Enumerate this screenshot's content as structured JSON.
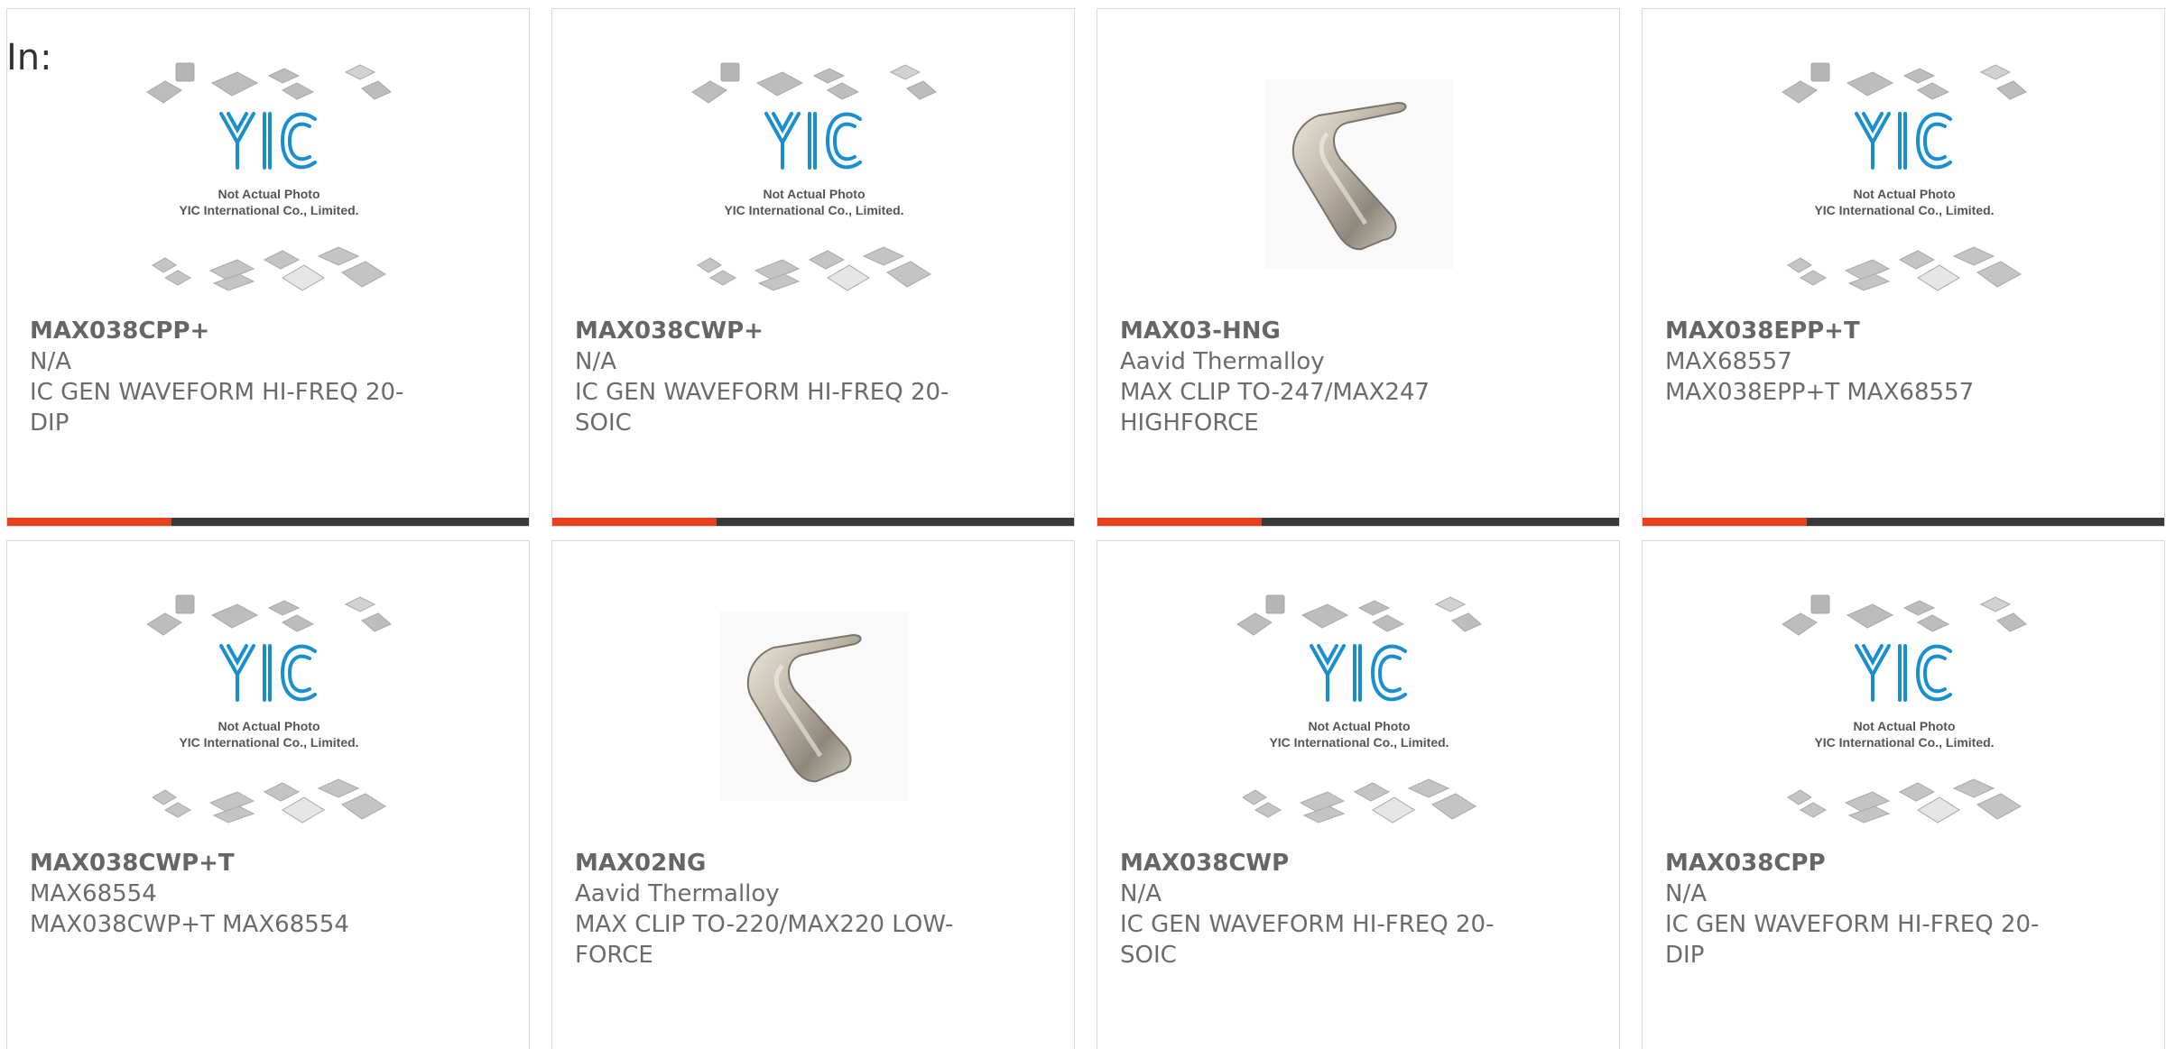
{
  "header": {
    "prefix": "In:"
  },
  "colors": {
    "accent": "#e8401c",
    "bar": "#3a3a3a",
    "logo_blue": "#1a8fd0"
  },
  "placeholder_image": {
    "icon": "yic-placeholder-icon",
    "line1": "Not Actual Photo",
    "line2": "YIC International Co., Limited."
  },
  "products": [
    {
      "part": "MAX038CPP+",
      "maker": "N/A",
      "desc": "IC GEN WAVEFORM HI-FREQ 20-DIP",
      "image": "placeholder"
    },
    {
      "part": "MAX038CWP+",
      "maker": "N/A",
      "desc": "IC GEN WAVEFORM HI-FREQ 20-SOIC",
      "image": "placeholder"
    },
    {
      "part": "MAX03-HNG",
      "maker": "Aavid Thermalloy",
      "desc": "MAX CLIP TO-247/MAX247 HIGHFORCE",
      "image": "clip"
    },
    {
      "part": "MAX038EPP+T",
      "maker": "MAX68557",
      "desc": "MAX038EPP+T MAX68557",
      "image": "placeholder"
    },
    {
      "part": "MAX038CWP+T",
      "maker": "MAX68554",
      "desc": "MAX038CWP+T MAX68554",
      "image": "placeholder"
    },
    {
      "part": "MAX02NG",
      "maker": "Aavid Thermalloy",
      "desc": "MAX CLIP TO-220/MAX220 LOW-FORCE",
      "image": "clip"
    },
    {
      "part": "MAX038CWP",
      "maker": "N/A",
      "desc": "IC GEN WAVEFORM HI-FREQ 20-SOIC",
      "image": "placeholder"
    },
    {
      "part": "MAX038CPP",
      "maker": "N/A",
      "desc": "IC GEN WAVEFORM HI-FREQ 20-DIP",
      "image": "placeholder"
    }
  ]
}
